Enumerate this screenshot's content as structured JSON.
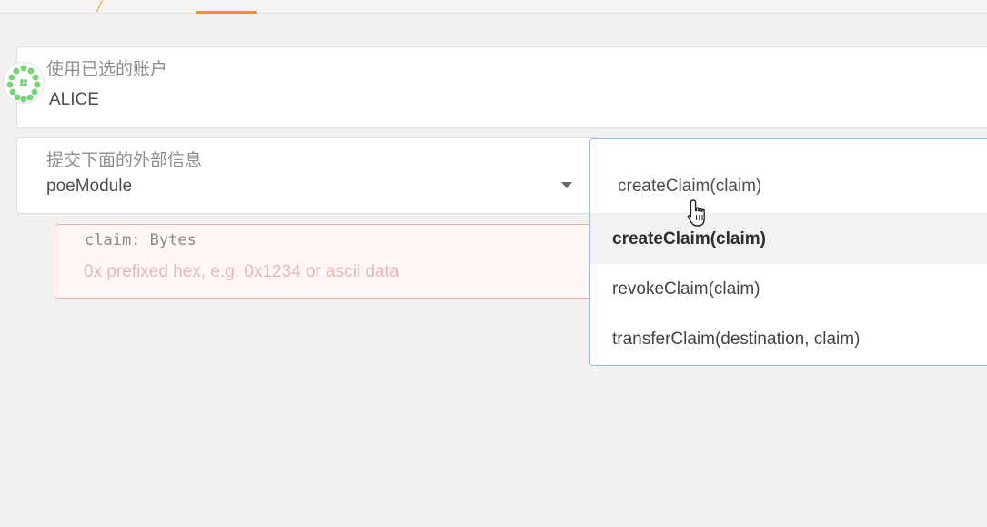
{
  "account": {
    "label": "使用已选的账户",
    "value": "ALICE"
  },
  "extrinsic": {
    "label": "提交下面的外部信息",
    "module": "poeModule"
  },
  "param": {
    "label": "claim: Bytes",
    "placeholder": "0x prefixed hex, e.g. 0x1234 or ascii data"
  },
  "method": {
    "current": "createClaim(claim)",
    "options": [
      "createClaim(claim)",
      "revokeClaim(claim)",
      "transferClaim(destination, claim)"
    ]
  },
  "colors": {
    "accent": "#f19135",
    "error_border": "#e7b4b4",
    "focus_border": "#99bfd4"
  }
}
